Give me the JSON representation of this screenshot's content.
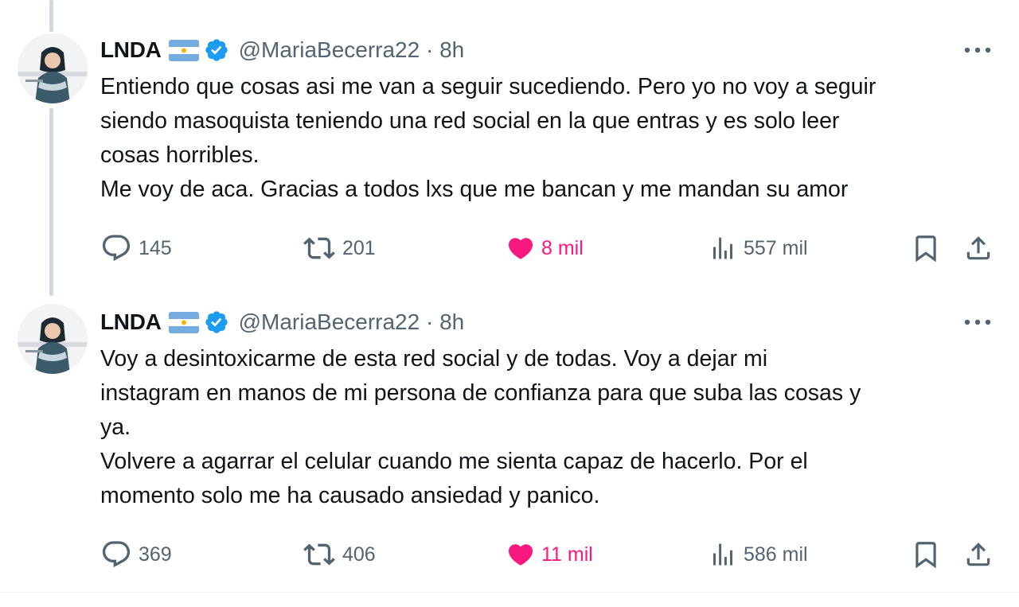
{
  "colors": {
    "text": "#0f1419",
    "muted": "#536471",
    "like": "#f91880",
    "verified": "#1d9bf0",
    "thread_line": "#cfd9de"
  },
  "tweets": [
    {
      "author_name": "LNDA",
      "author_flag": "argentina-flag",
      "handle_time": "@MariaBecerra22 · 8h",
      "lines": [
        "Entiendo que cosas asi me van a seguir sucediendo. Pero yo no voy a seguir",
        "siendo masoquista teniendo una red social en la que entras y es solo leer",
        "cosas horribles.",
        "Me voy de aca. Gracias a todos lxs que me bancan y me mandan su amor"
      ],
      "replies": "145",
      "reposts": "201",
      "likes": "8 mil",
      "views": "557 mil",
      "liked": true
    },
    {
      "author_name": "LNDA",
      "author_flag": "argentina-flag",
      "handle_time": "@MariaBecerra22 · 8h",
      "lines": [
        "Voy a desintoxicarme de esta red social y de todas. Voy a dejar mi",
        "instagram en manos de mi persona de confianza para que suba las cosas y",
        "ya.",
        "Volvere a agarrar el celular cuando me sienta capaz de hacerlo. Por el",
        "momento solo me ha causado ansiedad y panico."
      ],
      "replies": "369",
      "reposts": "406",
      "likes": "11 mil",
      "views": "586 mil",
      "liked": true
    }
  ]
}
